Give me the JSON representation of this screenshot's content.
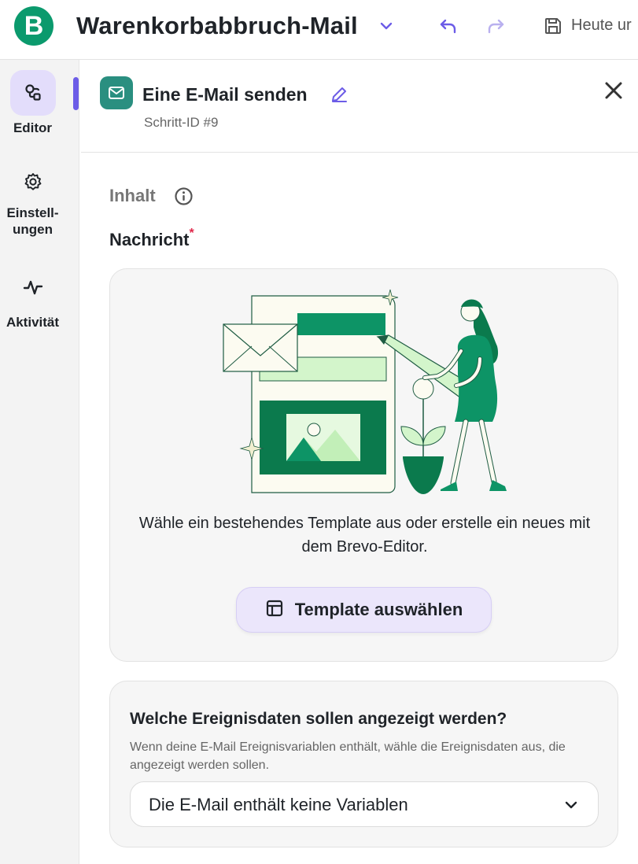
{
  "header": {
    "logo_letter": "B",
    "title": "Warenkorbabbruch-Mail",
    "save_label": "Heute ur",
    "brand_color": "#0b9a6d",
    "icons": [
      "chevron-down-icon",
      "undo-icon",
      "redo-icon",
      "save-icon"
    ]
  },
  "nav": {
    "items": [
      {
        "label": "Editor",
        "icon": "workflow-icon",
        "active": true
      },
      {
        "label": "Einstell-\nungen",
        "icon": "gear-icon",
        "active": false
      },
      {
        "label": "Aktivität",
        "icon": "activity-icon",
        "active": false
      }
    ],
    "accent": "#6c5ce7"
  },
  "step": {
    "title": "Eine E-Mail senden",
    "id_label": "Schritt-ID #9",
    "icon": "mail-icon",
    "icon_color": "#2a8f80"
  },
  "content": {
    "section_label": "Inhalt",
    "message_label": "Nachricht",
    "required_mark": "*",
    "message_card": {
      "text": "Wähle ein bestehendes Template aus oder erstelle ein neues mit dem Brevo-Editor.",
      "button_label": "Template auswählen",
      "button_icon": "layout-icon"
    },
    "event_card": {
      "title": "Welche Ereignisdaten sollen angezeigt werden?",
      "description": "Wenn deine E-Mail Ereignisvariablen enthält, wähle die Ereignisdaten aus, die angezeigt werden sollen.",
      "select_value": "Die E-Mail enthält keine Variablen"
    }
  }
}
